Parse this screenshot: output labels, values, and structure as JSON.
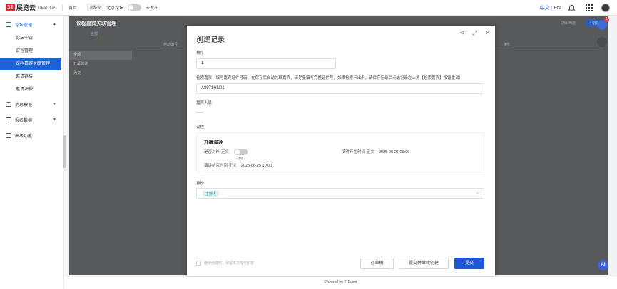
{
  "topbar": {
    "logo_mark": "31",
    "logo_text": "展览云",
    "logo_sub": "(TEST环境)",
    "home": "首页",
    "tag": "简略会",
    "forum": "北京论坛",
    "publish_status": "未发布",
    "lang_zh": "中文",
    "lang_sep": "|",
    "lang_en": "EN"
  },
  "sidebar": {
    "groups": [
      {
        "label": "论坛管理",
        "expanded": true
      },
      {
        "label": "消息模板"
      },
      {
        "label": "报名数据"
      },
      {
        "label": "高级功能"
      }
    ],
    "items": [
      "论坛申请",
      "议程管理",
      "议程嘉宾关联管理",
      "邀请链接",
      "邀请海报"
    ]
  },
  "background": {
    "page_title": "议程嘉宾关联管理",
    "tab": "全部",
    "left_list": [
      "全部",
      "开幕演讲",
      "为交"
    ],
    "head_cols": [
      "",
      "自动编号",
      "身份"
    ],
    "add_button": "+ 记录",
    "toolbar": "导出  筛选"
  },
  "modal": {
    "title": "创建记录",
    "sort_label": "排序",
    "sort_value": "1",
    "guest_search_label": "检索嘉宾（填写嘉宾证件号码，在保存后自动关联嘉宾，请尽量填写完整证件号，如果检索不出来，请保存记录后点选记录左上角【检索嘉宾】按钮重试）",
    "guest_search_value": "A8971HN01",
    "guest_people_label": "嘉宾人员",
    "agenda_label": "议程",
    "agenda": {
      "title": "开幕演讲",
      "is_public_label": "是否对外-正文",
      "toggle_label": "对外",
      "start_label": "演讲开始时间-正文",
      "start_value": "2025-06-25 09:00",
      "end_label": "演讲结束时间-正文",
      "end_value": "2025-06-25 10:00"
    },
    "identity_label": "身份",
    "identity_value": "主持人",
    "continue_label": "继续创建时，保留本次提交内容",
    "btn_draft": "存草稿",
    "btn_submit_continue": "提交并继续创建",
    "btn_submit": "提交"
  },
  "right_rail": {
    "badge": "1",
    "ai": "AI"
  },
  "footer": {
    "text": "Powered by 31Event"
  },
  "colors": {
    "accent": "#1e56d8",
    "brand_red": "#d8262c",
    "chip": "#159b9e"
  }
}
